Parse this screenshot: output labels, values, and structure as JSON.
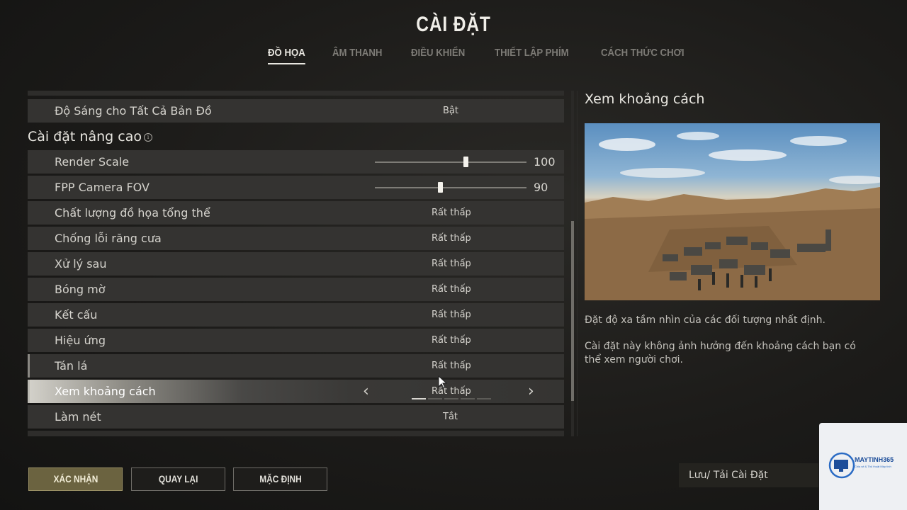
{
  "header": {
    "title": "CÀI ĐẶT",
    "tabs": [
      "ĐỒ HỌA",
      "ÂM THANH",
      "ĐIỀU KHIỂN",
      "THIẾT LẬP PHÍM",
      "CÁCH THỨC CHƠI"
    ],
    "active_tab": "ĐỒ HỌA"
  },
  "settings": {
    "brightness_row": {
      "label": "Độ Sáng cho Tất Cả Bản Đồ",
      "value": "Bật"
    },
    "advanced_section": {
      "title": "Cài đặt nâng cao"
    },
    "render_scale": {
      "label": "Render Scale",
      "value": "100",
      "slider_fraction": 0.6
    },
    "fpp_fov": {
      "label": "FPP Camera FOV",
      "value": "90",
      "slider_fraction": 0.43
    },
    "rows": [
      {
        "label": "Chất lượng đồ họa tổng thể",
        "value": "Rất thấp"
      },
      {
        "label": "Chống lỗi răng cưa",
        "value": "Rất thấp"
      },
      {
        "label": "Xử lý sau",
        "value": "Rất thấp"
      },
      {
        "label": "Bóng mờ",
        "value": "Rất thấp"
      },
      {
        "label": "Kết cấu",
        "value": "Rất thấp"
      },
      {
        "label": "Hiệu ứng",
        "value": "Rất thấp"
      },
      {
        "label": "Tán lá",
        "value": "Rất thấp"
      }
    ],
    "view_distance": {
      "label": "Xem khoảng cách",
      "value": "Rất thấp",
      "level": 1,
      "levels": 5
    },
    "sharpen": {
      "label": "Làm nét",
      "value": "Tắt"
    }
  },
  "detail": {
    "title": "Xem khoảng cách",
    "description_1": "Đặt độ xa tầm nhìn của các đối tượng nhất định.",
    "description_2": "Cài đặt này không ảnh hưởng đến khoảng cách bạn có thể xem người chơi."
  },
  "footer": {
    "confirm": "XÁC NHẬN",
    "back": "QUAY LẠI",
    "default": "MẶC ĐỊNH",
    "save_load": "Lưu/ Tải Cài Đặt"
  },
  "watermark": {
    "brand": "MAYTINH365",
    "tagline": "Chia sẻ & Thủ thuật Máy tính"
  },
  "colors": {
    "primary_button": "#6b6340",
    "selected_row": "#d4d2cb",
    "background": "#1c1b19"
  }
}
